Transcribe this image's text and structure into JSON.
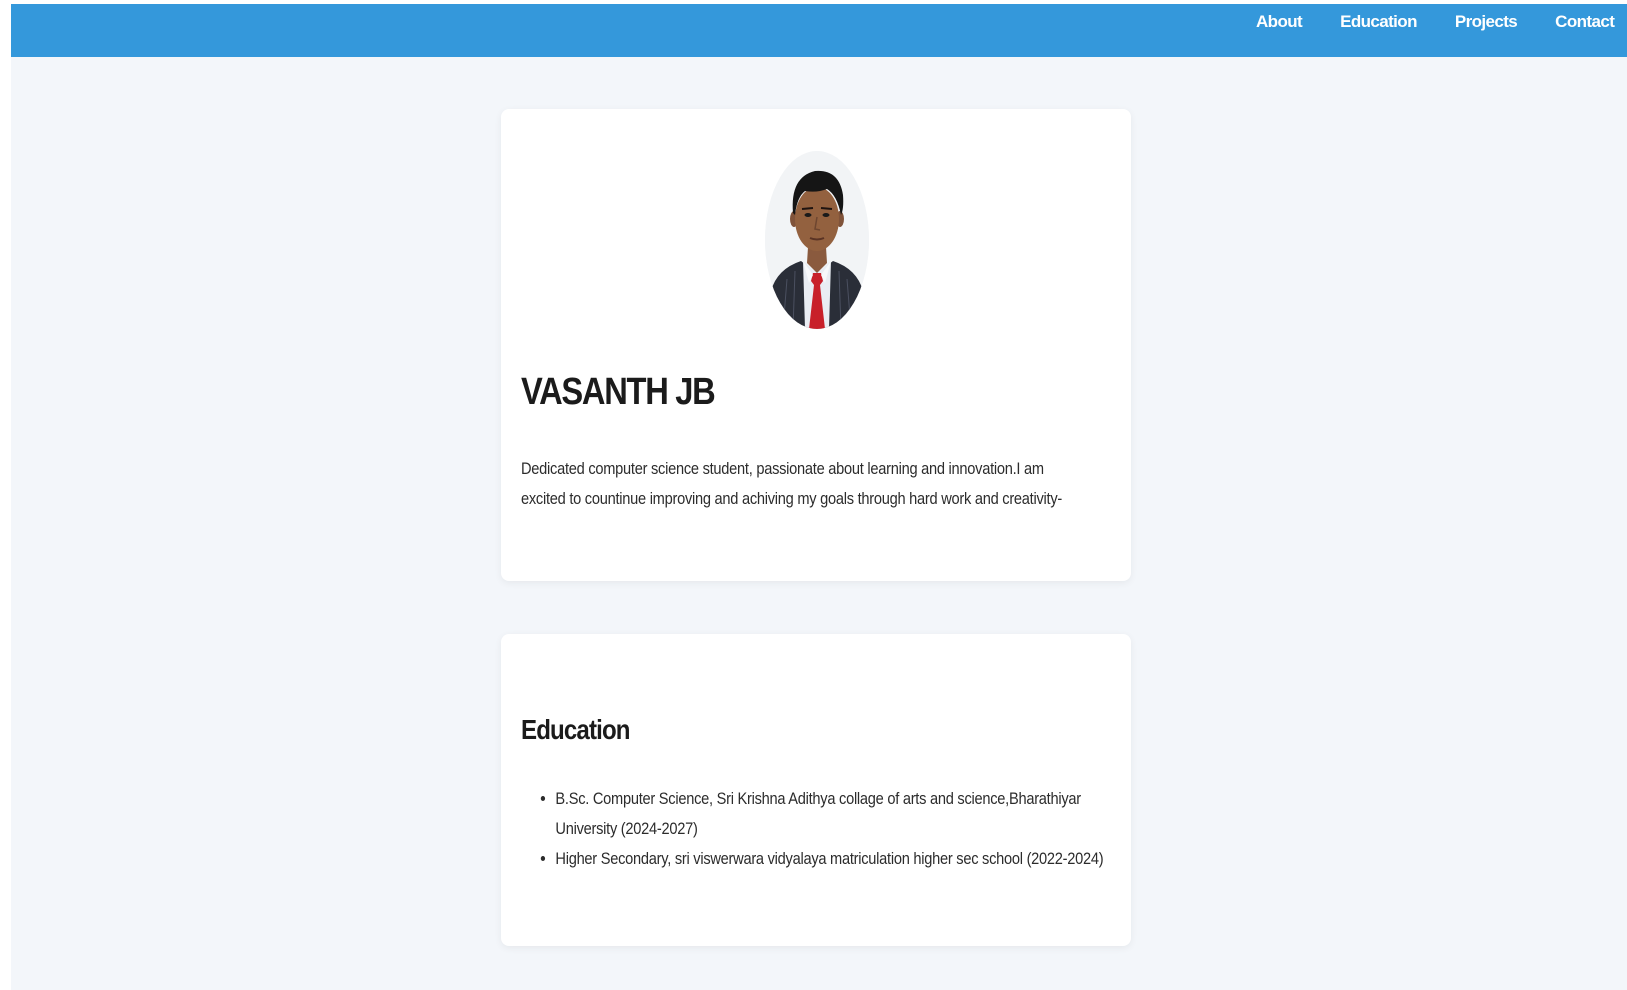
{
  "nav": {
    "items": [
      {
        "label": "About"
      },
      {
        "label": "Education"
      },
      {
        "label": "Projects"
      },
      {
        "label": "Contact"
      }
    ]
  },
  "about": {
    "name": "VASANTH JB",
    "bio": "Dedicated computer science student, passionate about learning and innovation.I am excited to countinue improving and achiving my goals through hard work and creativity-"
  },
  "education": {
    "heading": "Education",
    "items": [
      "B.Sc. Computer Science, Sri Krishna Adithya collage of arts and science,Bharathiyar University (2024-2027)",
      "Higher Secondary, sri viswerwara vidyalaya matriculation higher sec school (2022-2024)"
    ]
  },
  "colors": {
    "navbar": "#3498db",
    "page_background": "#f3f6fa",
    "card_background": "#ffffff",
    "text": "#1b1b1b"
  }
}
